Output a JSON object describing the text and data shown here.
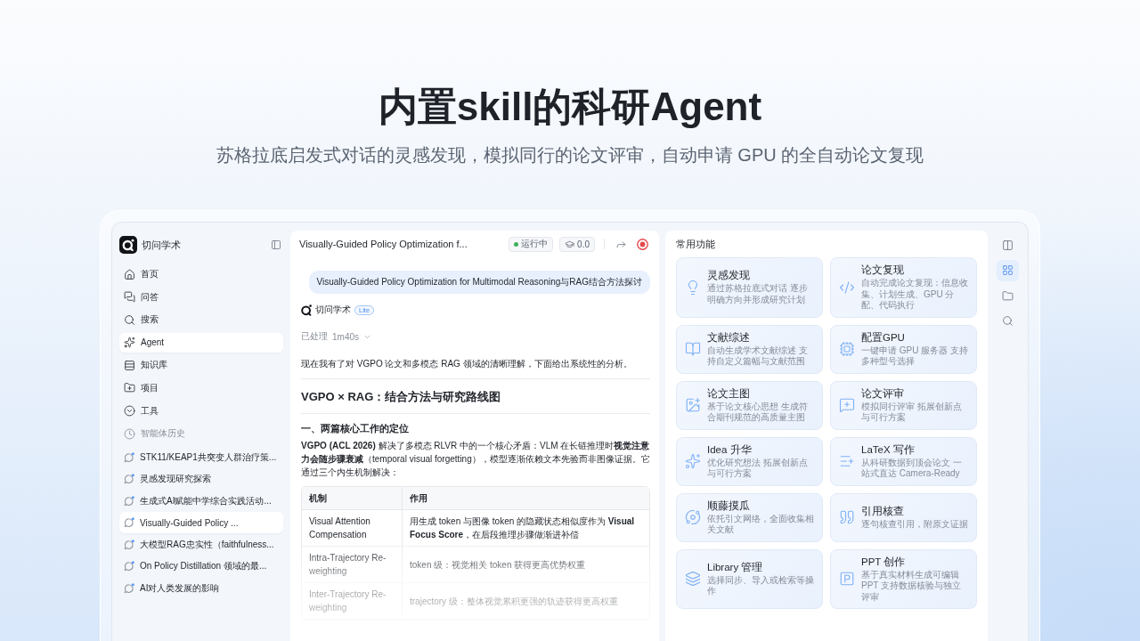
{
  "hero": {
    "title": "内置skill的科研Agent",
    "subtitle": "苏格拉底启发式对话的灵感发现，模拟同行的论文评审，自动申请 GPU 的全自动论文复现"
  },
  "sidebar": {
    "brand": "切问学术",
    "nav": [
      {
        "label": "首页",
        "selected": false
      },
      {
        "label": "问答",
        "selected": false
      },
      {
        "label": "搜索",
        "selected": false
      },
      {
        "label": "Agent",
        "selected": true
      },
      {
        "label": "知识库",
        "selected": false
      },
      {
        "label": "项目",
        "selected": false
      },
      {
        "label": "工具",
        "selected": false
      }
    ],
    "history_title": "智能体历史",
    "history": [
      {
        "label": "STK11/KEAP1共突变人群治疗策...",
        "selected": false
      },
      {
        "label": "灵感发现研究探索",
        "selected": false
      },
      {
        "label": "生成式AI赋能中学综合实践活动...",
        "selected": false
      },
      {
        "label": "Visually-Guided Policy ...",
        "selected": true
      },
      {
        "label": "大模型RAG忠实性（faithfulness...",
        "selected": false
      },
      {
        "label": "On Policy Distillation 领域的最...",
        "selected": false
      },
      {
        "label": "AI对人类发展的影响",
        "selected": false
      }
    ]
  },
  "chat": {
    "title": "Visually-Guided Policy Optimization f...",
    "status": "运行中",
    "score": "0.0",
    "user_message": "Visually-Guided Policy Optimization for Multimodal Reasoning与RAG结合方法探讨",
    "assistant_name": "切问学术",
    "assistant_badge": "Lite",
    "processed_label": "已处理",
    "processed_time": "1m40s",
    "intro": "现在我有了对 VGPO 论文和多模态 RAG 领域的清晰理解，下面给出系统性的分析。",
    "heading": "VGPO × RAG：结合方法与研究路线图",
    "section_title": "一、两篇核心工作的定位",
    "paragraph": "**VGPO (ACL 2026)** 解决了多模态 RLVR 中的一个核心矛盾：VLM 在长链推理时**视觉注意力会随步骤衰减**（temporal visual forgetting），模型逐渐依赖文本先验而非图像证据。它通过三个内生机制解决：",
    "table": {
      "columns": [
        "机制",
        "作用"
      ],
      "rows": [
        [
          "Visual Attention Compensation",
          "用生成 token 与图像 token 的隐藏状态相似度作为 **Visual Focus Score**，在后段推理步骤做渐进补偿"
        ],
        [
          "Intra-Trajectory Re-weighting",
          "token 级：视觉相关 token 获得更高优势权重"
        ],
        [
          "Inter-Trajectory Re-weighting",
          "trajectory 级：整体视觉累积更强的轨迹获得更高权重"
        ]
      ]
    }
  },
  "features": {
    "title": "常用功能",
    "items": [
      {
        "title": "灵感发现",
        "description": "通过苏格拉底式对话 逐步明确方向并形成研究计划"
      },
      {
        "title": "论文复现",
        "description": "自动完成论文复现：信息收集、计划生成、GPU 分配、代码执行"
      },
      {
        "title": "文献综述",
        "description": "自动生成学术文献综述 支持自定义篇幅与文献范围"
      },
      {
        "title": "配置GPU",
        "description": "一键申请 GPU 服务器 支持多种型号选择"
      },
      {
        "title": "论文主图",
        "description": "基于论文核心思想 生成符合期刊规范的高质量主图"
      },
      {
        "title": "论文评审",
        "description": "模拟同行评审 拓展创新点与可行方案"
      },
      {
        "title": "Idea 升华",
        "description": "优化研究想法 拓展创新点与可行方案"
      },
      {
        "title": "LaTeX 写作",
        "description": "从科研数据到顶会论文 一站式直达 Camera-Ready"
      },
      {
        "title": "顺藤摸瓜",
        "description": "依托引文网络，全面收集相关文献"
      },
      {
        "title": "引用核查",
        "description": "逐句核查引用，附原文证据"
      },
      {
        "title": "Library 管理",
        "description": "选择同步、导入或检索等操作"
      },
      {
        "title": "PPT 创作",
        "description": "基于真实材料生成可编辑 PPT 支持数据核验与独立评审"
      }
    ]
  },
  "rail": [
    {
      "selected": false
    },
    {
      "selected": true
    },
    {
      "selected": false
    },
    {
      "selected": false
    }
  ]
}
